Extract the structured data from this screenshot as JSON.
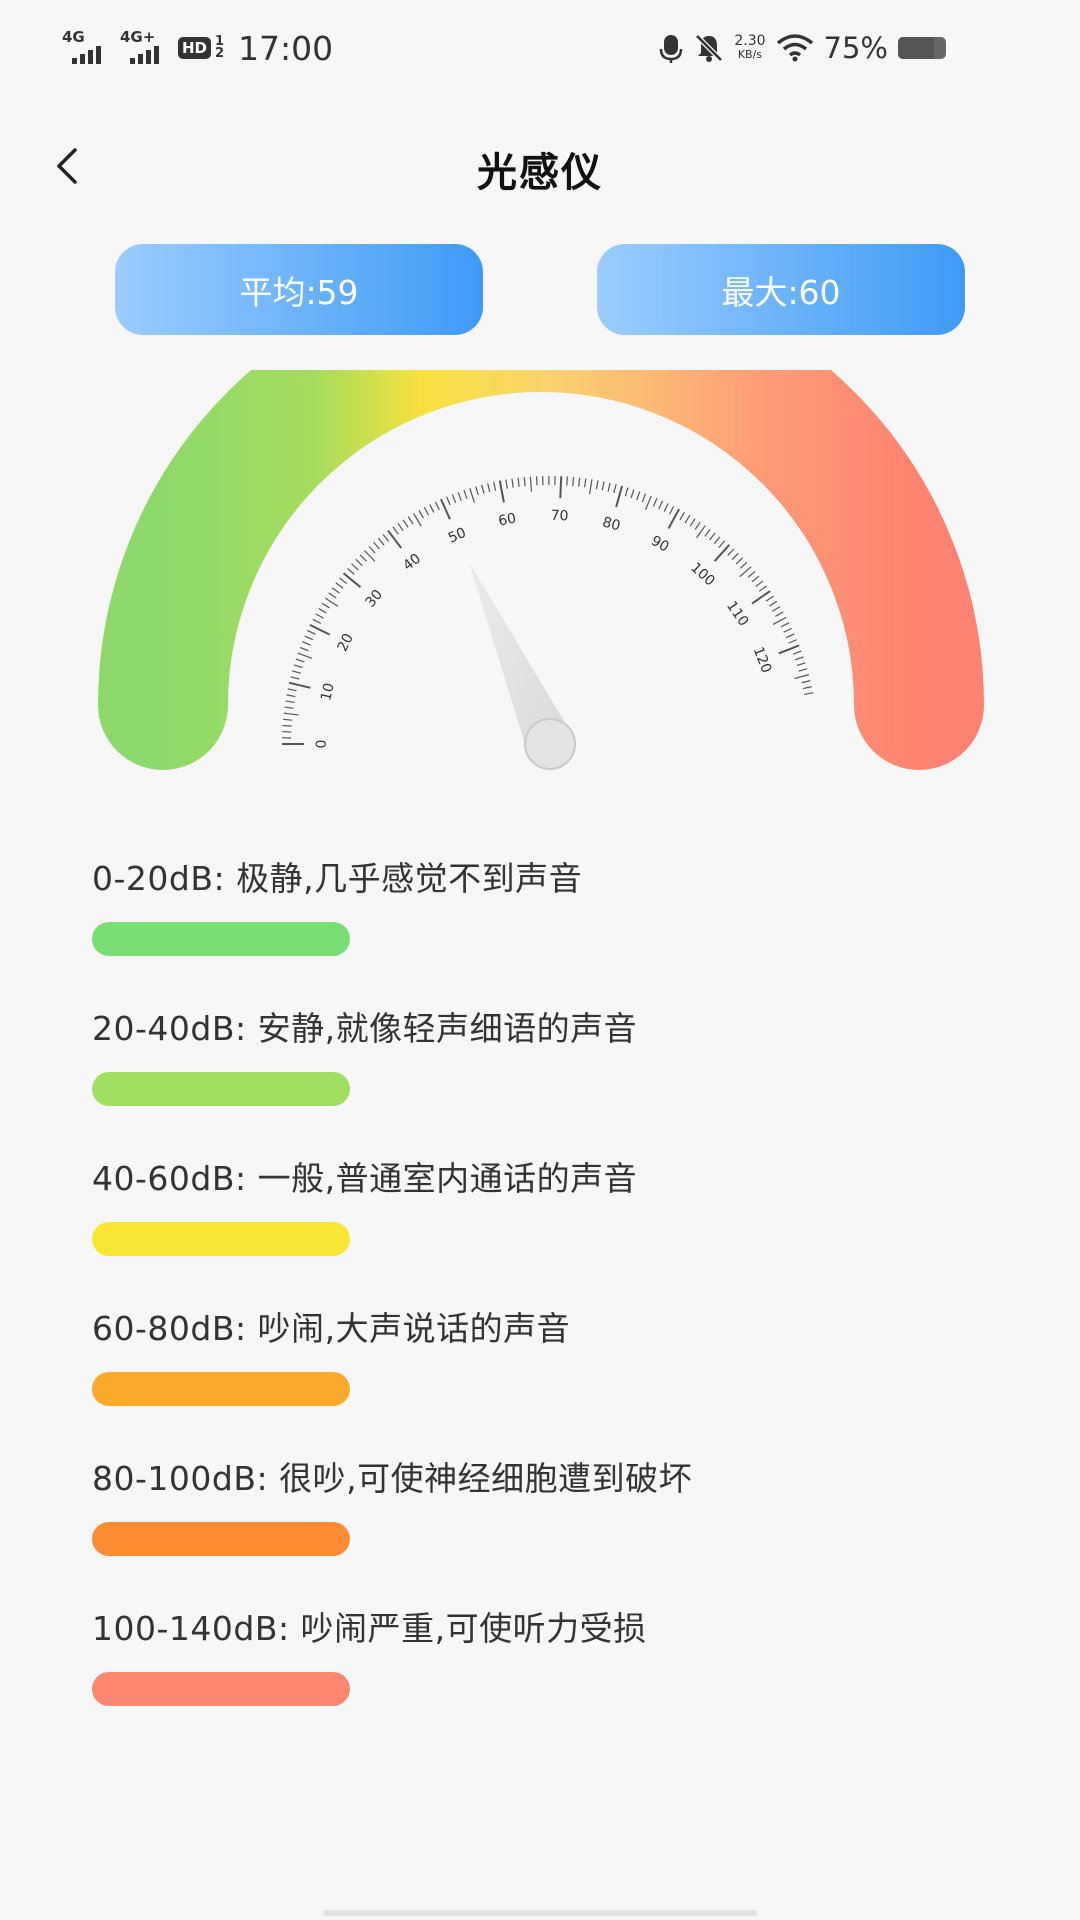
{
  "status_bar": {
    "signal1_label": "4G",
    "signal2_label": "4G+",
    "hd_label": "HD",
    "hd_fraction_top": "1",
    "hd_fraction_bottom": "2",
    "time": "17:00",
    "net_speed_value": "2.30",
    "net_speed_unit": "KB/s",
    "battery_percent": "75%",
    "battery_level": 0.75,
    "icons": [
      "microphone-icon",
      "mute-bell-icon",
      "wifi-icon",
      "battery-icon"
    ]
  },
  "header": {
    "title": "光感仪",
    "back_icon": "chevron-left-icon"
  },
  "stats": {
    "avg_label": "平均:59",
    "max_label": "最大:60"
  },
  "gauge": {
    "tick_labels": [
      "0",
      "10",
      "20",
      "30",
      "40",
      "50",
      "60",
      "70",
      "80",
      "90",
      "100",
      "110",
      "120"
    ],
    "needle_value": 50,
    "colors": {
      "green": "#8ed96b",
      "yellow": "#f6e13f",
      "orange": "#fbbf74",
      "red": "#ff8370",
      "needle": "#e6e6e6"
    }
  },
  "legend": [
    {
      "text": "0-20dB: 极静,几乎感觉不到声音",
      "color": "#79df74"
    },
    {
      "text": "20-40dB: 安静,就像轻声细语的声音",
      "color": "#9fe060"
    },
    {
      "text": "40-60dB: 一般,普通室内通话的声音",
      "color": "#f7e733"
    },
    {
      "text": "60-80dB: 吵闹,大声说话的声音",
      "color": "#fcaa2c"
    },
    {
      "text": "80-100dB: 很吵,可使神经细胞遭到破坏",
      "color": "#fd8c32"
    },
    {
      "text": "100-140dB: 吵闹严重,可使听力受损",
      "color": "#fe8770"
    }
  ]
}
